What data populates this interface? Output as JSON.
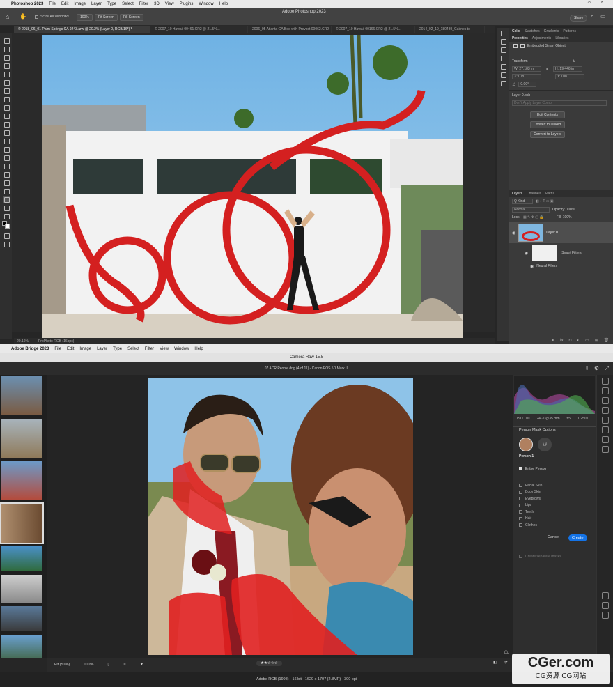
{
  "ps": {
    "menubar": {
      "apple": "",
      "app": "Photoshop 2023",
      "items": [
        "File",
        "Edit",
        "Image",
        "Layer",
        "Type",
        "Select",
        "Filter",
        "3D",
        "View",
        "Plugins",
        "Window",
        "Help"
      ]
    },
    "options": {
      "scroll_all": "Scroll All Windows",
      "zoom": "100%",
      "fit": "Fit Screen",
      "fill": "Fill Screen",
      "title": "Adobe Photoshop 2023",
      "share": "Share"
    },
    "tabs": [
      "© 2018_06_01-Palm Springs CA 9243.arw @ 20.2% (Layer 0, RGB/16*) *",
      "© 2007_10 Hawaii 00461.CR2 @ 21.5%...",
      "2006_05 Atlanta GA Bee with Prevost 00062.CR2",
      "© 2007_10 Hawaii 00166.CR2 @ 21.5%...",
      "2014_02_19_180439_Cairnes te"
    ],
    "status": {
      "zoom": "20.16%",
      "profile": "ProPhoto RGB (16bpc)"
    },
    "panel": {
      "top_tabs": [
        "Color",
        "Swatches",
        "Gradients",
        "Patterns"
      ],
      "prop_tabs": [
        "Properties",
        "Adjustments",
        "Libraries"
      ],
      "smart_object": "Embedded Smart Object",
      "transform": "Transform",
      "w": "W: 27.183 in",
      "h": "H: 19.446 in",
      "x": "X: 0 in",
      "y": "Y: 0 in",
      "angle": "0.00°",
      "layer_file": "Layer 0.psb",
      "comps": "Don't Apply Layer Comp",
      "edit_contents": "Edit Contents",
      "convert_linked": "Convert to Linked...",
      "convert_layers": "Convert to Layers"
    },
    "layers": {
      "tabs": [
        "Layers",
        "Channels",
        "Paths"
      ],
      "kind": "Q Kind",
      "blend": "Normal",
      "opacity": "Opacity: 100%",
      "lock": "Lock:",
      "fill": "Fill: 100%",
      "layer0": "Layer 0",
      "smart_filters": "Smart Filters",
      "neural": "Neural Filters"
    }
  },
  "br": {
    "menubar": {
      "apple": "",
      "app": "Adobe Bridge 2023",
      "items": [
        "File",
        "Edit",
        "Image",
        "Layer",
        "Type",
        "Select",
        "Filter",
        "View",
        "Window",
        "Help"
      ]
    },
    "title": "Camera Raw 15.5",
    "subtitle": "07 ACR People.dng (4 of 11)  -  Canon EOS 5D Mark III",
    "info": {
      "iso": "ISO 100",
      "lens": "24-70@35 mm",
      "fstop": "f/5",
      "shutter": "1/250s"
    },
    "mask": {
      "heading": "Person Mask Options",
      "person": "Person 1",
      "entire": "Entire Person",
      "options": [
        "Facial Skin",
        "Body Skin",
        "Eyebrows",
        "Lips",
        "Teeth",
        "Hair",
        "Clothes"
      ],
      "cancel": "Cancel",
      "create": "Create",
      "separate": "Create separate masks"
    },
    "bottom": {
      "fit": "Fit (51%)",
      "zoom": "100%",
      "stars": "★★☆☆☆",
      "footer": "Adobe RGB (1998) - 16 bit - 1629 x 1707 (2.8MP) - 300 ppi"
    }
  },
  "watermark": {
    "main": "CGer.com",
    "sub": "CG资源 CG网站"
  },
  "colors": {
    "accent": "#1473e6",
    "mask_red": "#e02020",
    "sky": "#8ec3e8"
  }
}
